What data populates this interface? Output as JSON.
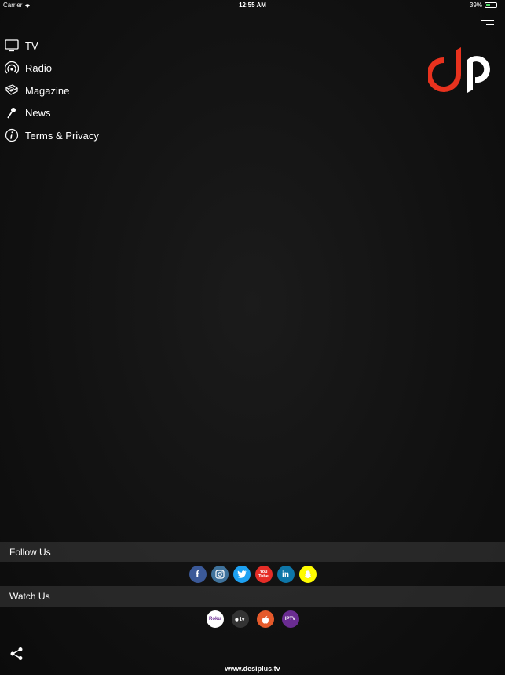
{
  "status": {
    "carrier": "Carrier",
    "time": "12:55 AM",
    "battery": "39%",
    "battery_level": 0.39
  },
  "menu": [
    {
      "label": "TV",
      "icon": "tv-icon"
    },
    {
      "label": "Radio",
      "icon": "radio-icon"
    },
    {
      "label": "Magazine",
      "icon": "magazine-icon"
    },
    {
      "label": "News",
      "icon": "microphone-icon"
    },
    {
      "label": "Terms & Privacy",
      "icon": "info-icon"
    }
  ],
  "follow": {
    "title": "Follow Us",
    "icons": [
      {
        "name": "facebook-icon",
        "text": "f",
        "color": "#3b5998"
      },
      {
        "name": "instagram-icon",
        "text": "",
        "color": "#3f729b"
      },
      {
        "name": "twitter-icon",
        "text": "",
        "color": "#1da1f2"
      },
      {
        "name": "youtube-icon",
        "text": "You Tube",
        "color": "#e52d27"
      },
      {
        "name": "linkedin-icon",
        "text": "in",
        "color": "#0e76a8"
      },
      {
        "name": "snapchat-icon",
        "text": "",
        "color": "#fffc00"
      }
    ]
  },
  "watch": {
    "title": "Watch Us",
    "icons": [
      {
        "name": "roku-icon",
        "text": "Roku",
        "color": "#ffffff"
      },
      {
        "name": "apple-tv-icon",
        "text": "tv",
        "color": "#333333"
      },
      {
        "name": "apple-icon",
        "text": "",
        "color": "#e55a2b"
      },
      {
        "name": "iptv-icon",
        "text": "IPTV",
        "color": "#6a2c91"
      }
    ]
  },
  "footer": {
    "url": "www.desiplus.tv"
  },
  "logo": {
    "text": "dP",
    "colors": {
      "d": "#e8321e",
      "p": "#ffffff"
    }
  }
}
